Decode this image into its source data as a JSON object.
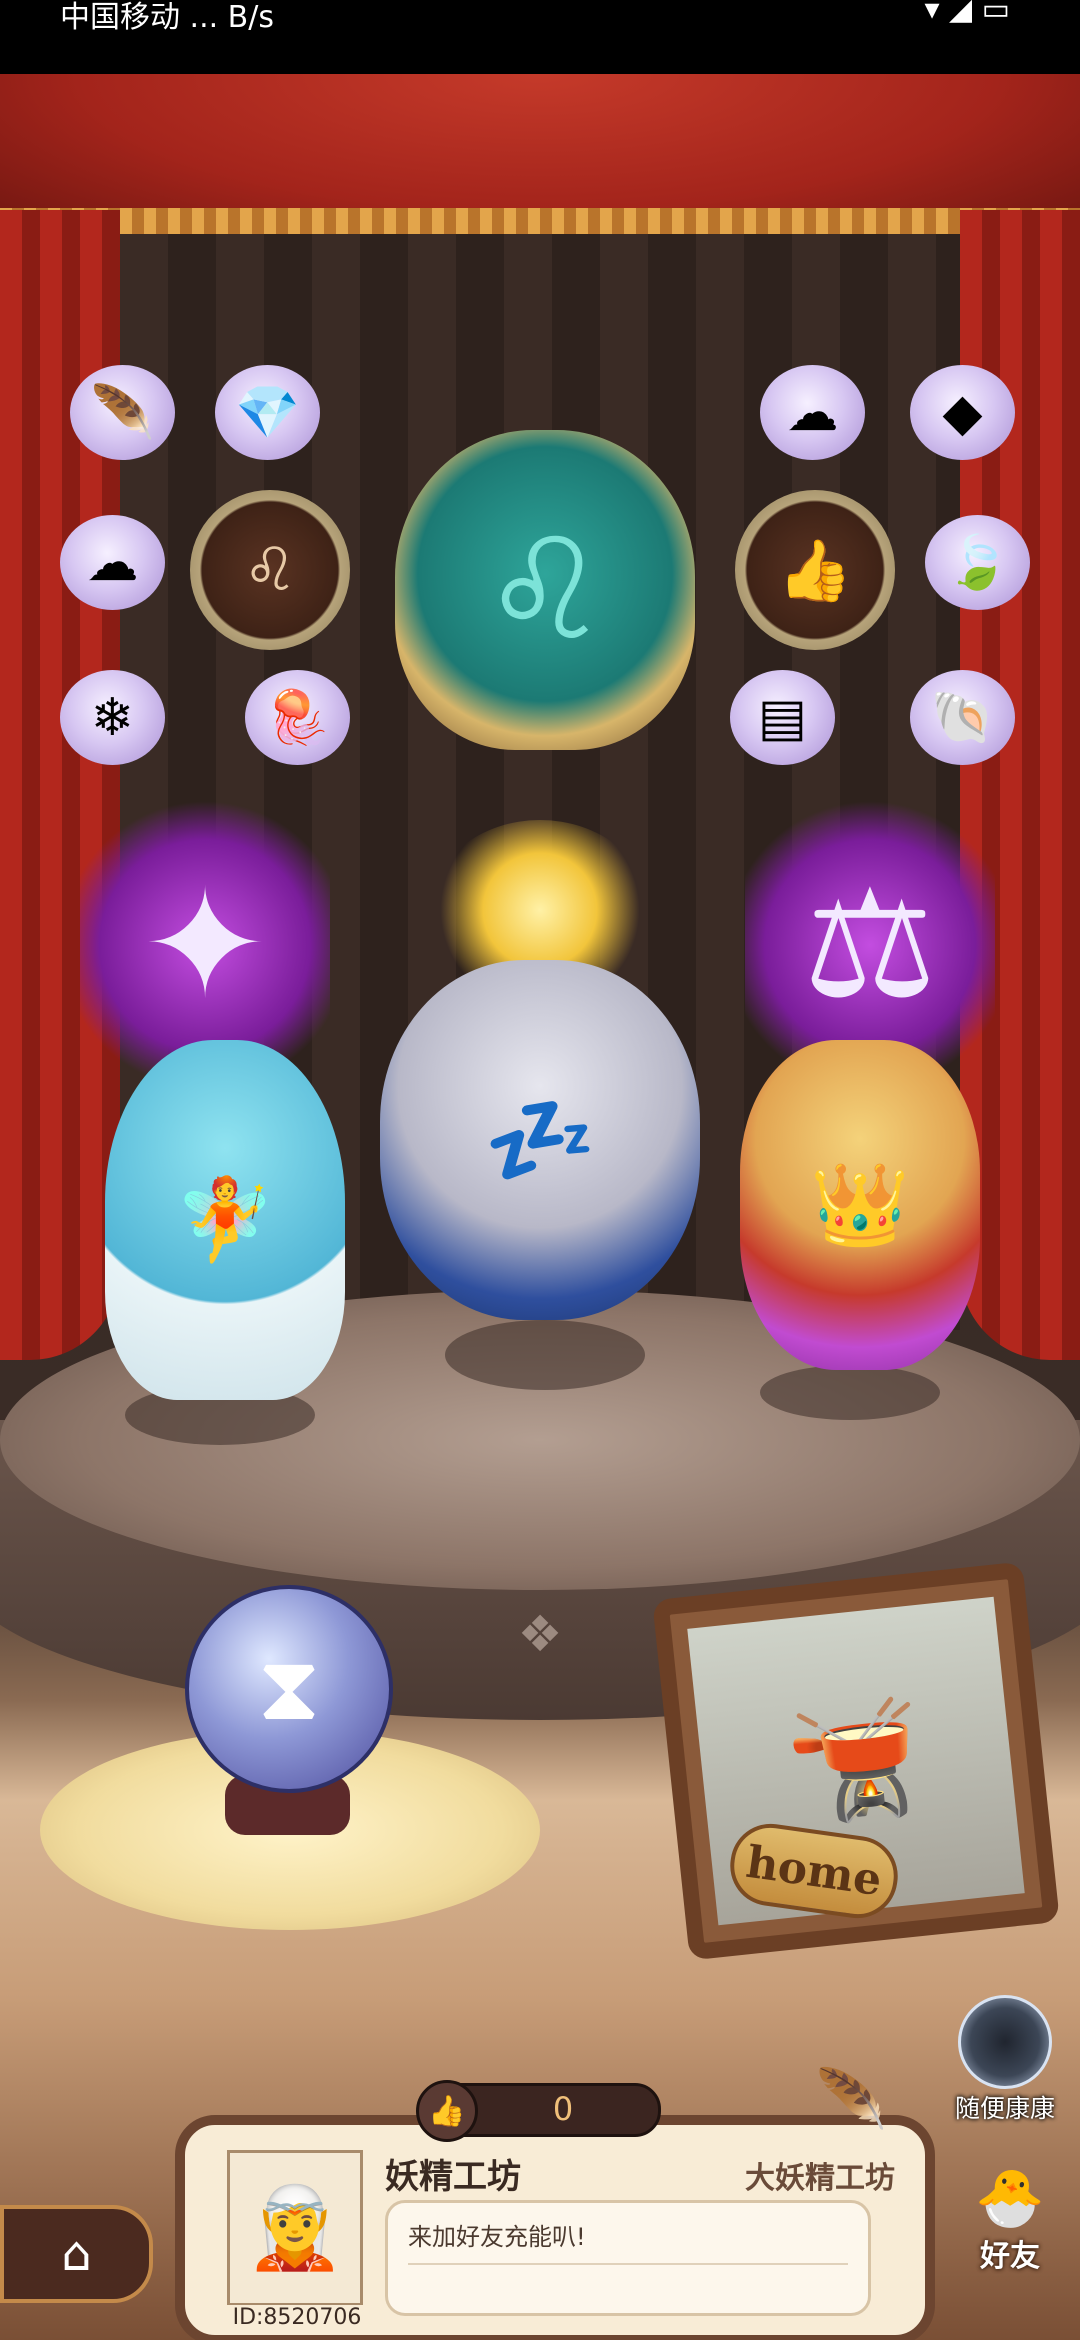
{
  "status_bar": {
    "left": "中国移动 ... B/s",
    "right": "▾ ◢ ▭"
  },
  "collectibles": {
    "left_column": [
      "rainbow-feather",
      "sun-cloud",
      "white-fur"
    ],
    "left_inner": [
      "cloud-crystal",
      "lion-medallion",
      "jellyfish"
    ],
    "right_inner": [
      "cloud-rock",
      "thumb-medallion",
      "silver-scale"
    ],
    "right_column": [
      "stone",
      "gold-leaf",
      "shell"
    ],
    "center_crest": "leo-crest-icon"
  },
  "stage": {
    "plaque_text": "home"
  },
  "side_buttons": {
    "random_visit_label": "随便康康",
    "friends_label": "好友"
  },
  "profile_card": {
    "like_count": "0",
    "shop_name": "妖精工坊",
    "shop_rank": "大妖精工坊",
    "message": "来加好友充能叭!",
    "user_id": "ID:8520706"
  }
}
